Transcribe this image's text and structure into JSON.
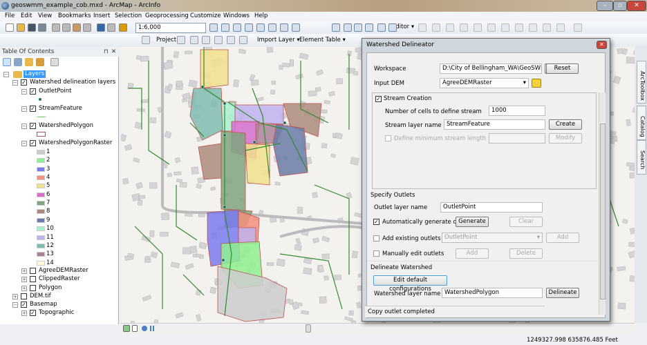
{
  "window": {
    "title": "geoswmm_example_cob.mxd - ArcMap - ArcInfo",
    "minimize": "–",
    "maximize": "▫",
    "close": "✕"
  },
  "menu": [
    "File",
    "Edit",
    "View",
    "Bookmarks",
    "Insert",
    "Selection",
    "Geoprocessing",
    "Customize",
    "Windows",
    "Help"
  ],
  "toolbar": {
    "scale": "1:6,000",
    "editor": "Editor ▾",
    "project": "Project ▾",
    "import_layer": "Import Layer ▾",
    "element_table": "Element Table ▾"
  },
  "toc": {
    "title": "Table Of Contents",
    "pin": "⊓",
    "close": "✕",
    "root": "Layers",
    "group": "Watershed delineation layers",
    "layers": [
      {
        "name": "OutletPoint",
        "checked": true
      },
      {
        "name": "StreamFeature",
        "checked": true
      },
      {
        "name": "WatershedPolygon",
        "checked": true
      },
      {
        "name": "WatershedPolygonRaster",
        "checked": true
      }
    ],
    "legend": [
      {
        "label": "1",
        "color": "#cccccc"
      },
      {
        "label": "2",
        "color": "#8ff08f"
      },
      {
        "label": "3",
        "color": "#7a7aee"
      },
      {
        "label": "4",
        "color": "#f5917c"
      },
      {
        "label": "5",
        "color": "#f1e08c"
      },
      {
        "label": "6",
        "color": "#d56fcc"
      },
      {
        "label": "7",
        "color": "#7ea57e"
      },
      {
        "label": "8",
        "color": "#ab8c7c"
      },
      {
        "label": "9",
        "color": "#6a7ba8"
      },
      {
        "label": "10",
        "color": "#a8f0cf"
      },
      {
        "label": "11",
        "color": "#c0b1ee"
      },
      {
        "label": "12",
        "color": "#7fbcb0"
      },
      {
        "label": "13",
        "color": "#a98499"
      },
      {
        "label": "14",
        "color": "#fff8da"
      }
    ],
    "other_layers": [
      {
        "name": "AgreeDEMRaster",
        "checked": false
      },
      {
        "name": "ClippedRaster",
        "checked": false
      },
      {
        "name": "Polygon",
        "checked": false
      }
    ],
    "dem": {
      "name": "DEM.tif",
      "checked": false
    },
    "basemap": {
      "name": "Basemap",
      "checked": true
    },
    "topographic": {
      "name": "Topographic",
      "checked": true
    }
  },
  "dock_tabs": [
    "ArcToolbox",
    "Catalog",
    "Search"
  ],
  "dialog": {
    "title": "Watershed Delineator",
    "close": "✕",
    "workspace_label": "Workspace",
    "workspace_value": "D:\\City of Bellingham_WA\\GeoSWMM",
    "reset": "Reset",
    "dem_label": "Input DEM",
    "dem_value": "AgreeDEMRaster",
    "stream_creation": "Stream Creation",
    "stream_creation_checked": true,
    "cells_label": "Number of cells to define stream",
    "cells_value": "1000",
    "stream_name_label": "Stream layer name",
    "stream_name_value": "StreamFeature",
    "create": "Create",
    "min_length_label": "Define minimum stream length",
    "modify": "Modify",
    "outlets_header": "Specify Outlets",
    "outlet_name_label": "Outlet layer name",
    "outlet_name_value": "OutletPoint",
    "auto_label": "Automatically generate outlets",
    "auto_checked": true,
    "generate": "Generate",
    "clear": "Clear",
    "existing_label": "Add existing outlets from",
    "existing_value": "OutletPoint",
    "add": "Add",
    "manual_label": "Manually edit outlets",
    "delete": "Delete",
    "delineate_header": "Delineate Watershed",
    "edit_defaults": "Edit default configurations",
    "watershed_name_label": "Watershed layer name",
    "watershed_name_value": "WatershedPolygon",
    "delineate": "Delineate",
    "status": "Copy outlet completed"
  },
  "status": {
    "coordinates": "1249327.998  635876.485 Feet"
  }
}
